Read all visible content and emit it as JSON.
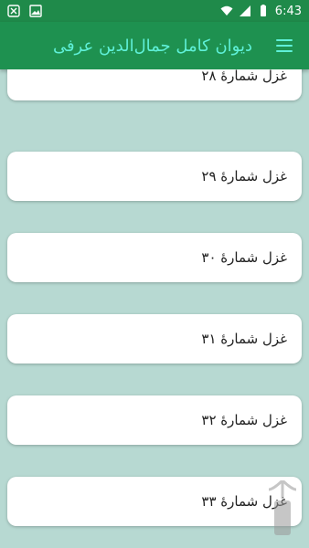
{
  "status_bar": {
    "time": "6:43",
    "icons": [
      "close-notification-icon",
      "image-notification-icon",
      "wifi-icon",
      "signal-icon",
      "battery-icon"
    ]
  },
  "app_bar": {
    "title": "دیوان کامل جمال‌الدین عرفی",
    "menu_icon": "menu-icon",
    "colors": {
      "background": "#1e9150",
      "title": "#5ff0d8"
    }
  },
  "list": {
    "items": [
      {
        "label": "غزل شمارهٔ ۲۸"
      },
      {
        "label": "غزل شمارهٔ ۲۹"
      },
      {
        "label": "غزل شمارهٔ ۳۰"
      },
      {
        "label": "غزل شمارهٔ ۳۱"
      },
      {
        "label": "غزل شمارهٔ ۳۲"
      },
      {
        "label": "غزل شمارهٔ ۳۳"
      }
    ]
  },
  "colors": {
    "page_background": "#b7d9d2",
    "card_background": "#ffffff"
  }
}
